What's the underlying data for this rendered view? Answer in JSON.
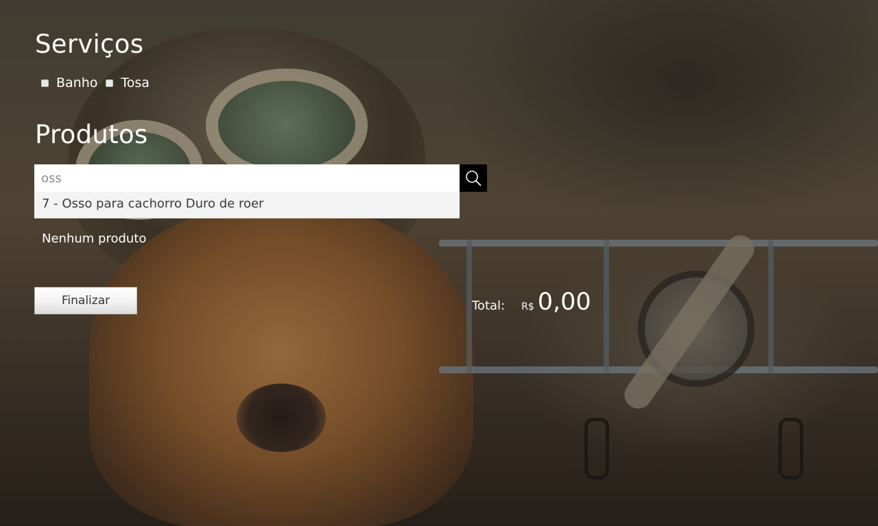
{
  "services": {
    "title": "Serviços",
    "options": [
      {
        "label": "Banho",
        "checked": false
      },
      {
        "label": "Tosa",
        "checked": false
      }
    ]
  },
  "products": {
    "title": "Produtos",
    "search": {
      "value": "oss",
      "button_icon": "search-icon"
    },
    "suggestions": [
      {
        "label": "7 - Osso para cachorro Duro de roer"
      }
    ],
    "empty_message": "Nenhum produto"
  },
  "actions": {
    "finalize_label": "Finalizar"
  },
  "total": {
    "label": "Total:",
    "currency": "R$",
    "value": "0,00"
  },
  "colors": {
    "search_button_bg": "#000000",
    "suggestion_bg": "#f3f3f3",
    "text_light": "#ffffff"
  }
}
